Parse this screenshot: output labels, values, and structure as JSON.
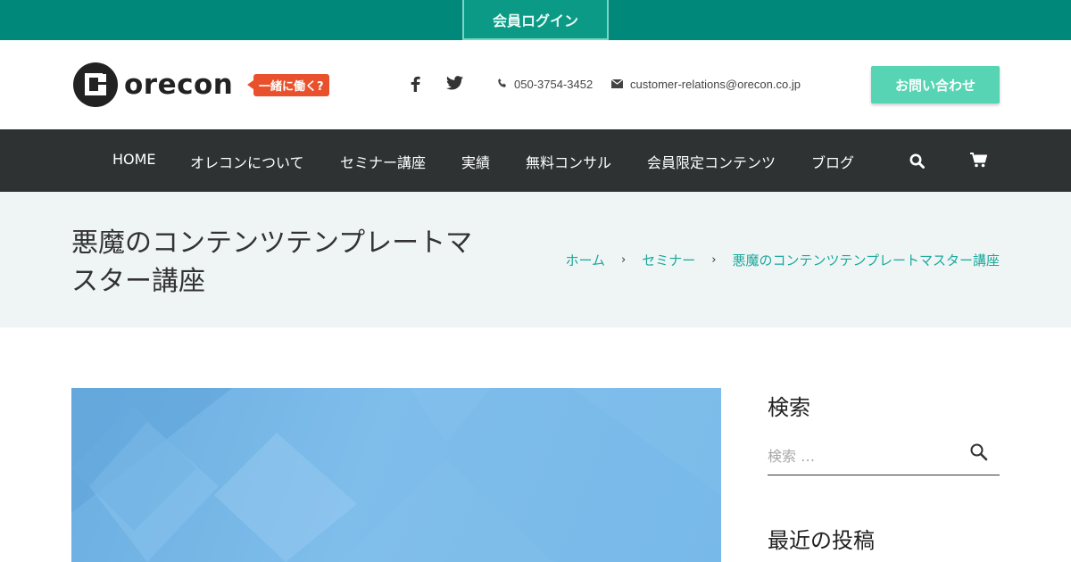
{
  "topbar": {
    "login_label": "会員ログイン"
  },
  "header": {
    "logo_text": "orecon",
    "work_badge": "一緒に働く?",
    "phone": "050-3754-3452",
    "email": "customer-relations@orecon.co.jp",
    "inquiry_label": "お問い合わせ",
    "social_icons": [
      "facebook-icon",
      "twitter-icon"
    ]
  },
  "nav": {
    "items": [
      {
        "label": "HOME"
      },
      {
        "label": "オレコンについて"
      },
      {
        "label": "セミナー講座"
      },
      {
        "label": "実績"
      },
      {
        "label": "無料コンサル"
      },
      {
        "label": "会員限定コンテンツ"
      },
      {
        "label": "ブログ"
      }
    ],
    "icons": [
      "search-icon",
      "cart-icon"
    ]
  },
  "title_band": {
    "title": "悪魔のコンテンツテンプレートマスター講座",
    "breadcrumb": [
      "ホーム",
      "セミナー",
      "悪魔のコンテンツテンプレートマスター講座"
    ]
  },
  "sidebar": {
    "search_heading": "検索",
    "search_placeholder": "検索 …",
    "recent_heading": "最近の投稿"
  },
  "colors": {
    "brand_teal": "#00897b",
    "nav_dark": "#2e3233",
    "inquiry_green": "#56d4b3",
    "badge_orange": "#e8512c",
    "link_teal": "#1aa89b"
  }
}
